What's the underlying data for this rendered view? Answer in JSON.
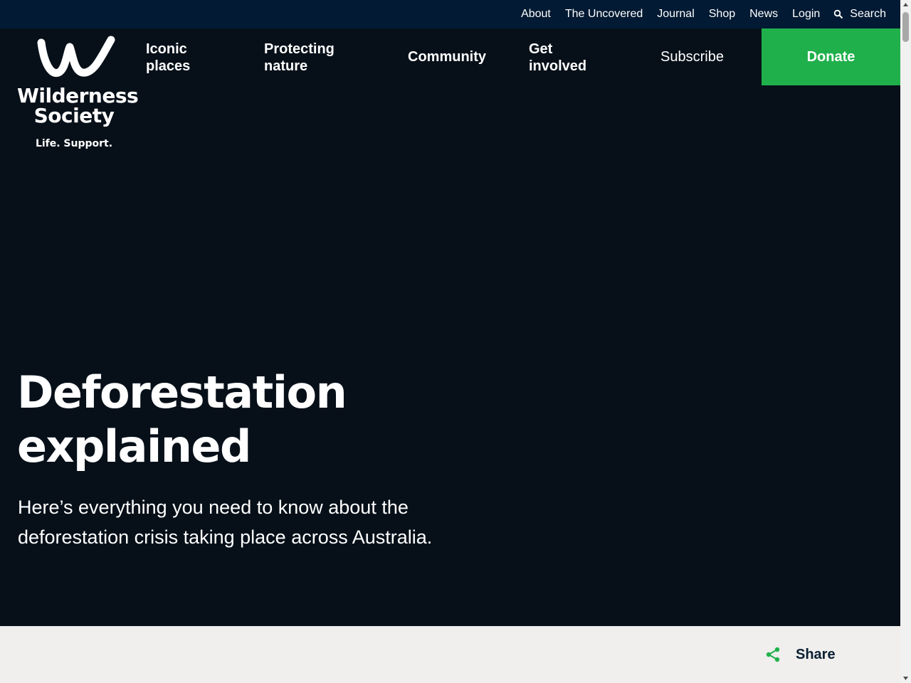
{
  "utility_nav": {
    "items": [
      "About",
      "The Uncovered",
      "Journal",
      "Shop",
      "News",
      "Login"
    ],
    "search_label": "Search"
  },
  "logo": {
    "line1": "Wilderness",
    "line2": "Society",
    "tagline": "Life. Support."
  },
  "main_nav": {
    "iconic_places": "Iconic places",
    "protecting_nature": "Protecting nature",
    "community": "Community",
    "get_involved": "Get involved",
    "subscribe": "Subscribe",
    "donate": "Donate"
  },
  "hero": {
    "title_line1": "Deforestation",
    "title_line2": "explained",
    "subtitle": "Here’s everything you need to know about the deforestation crisis taking place across Australia."
  },
  "share": {
    "label": "Share"
  },
  "colors": {
    "utility_bar": "#021a33",
    "background": "#071019",
    "donate": "#20b04b",
    "share_bar": "#f0efed",
    "share_icon": "#20b04b",
    "share_text": "#0a1e33"
  }
}
